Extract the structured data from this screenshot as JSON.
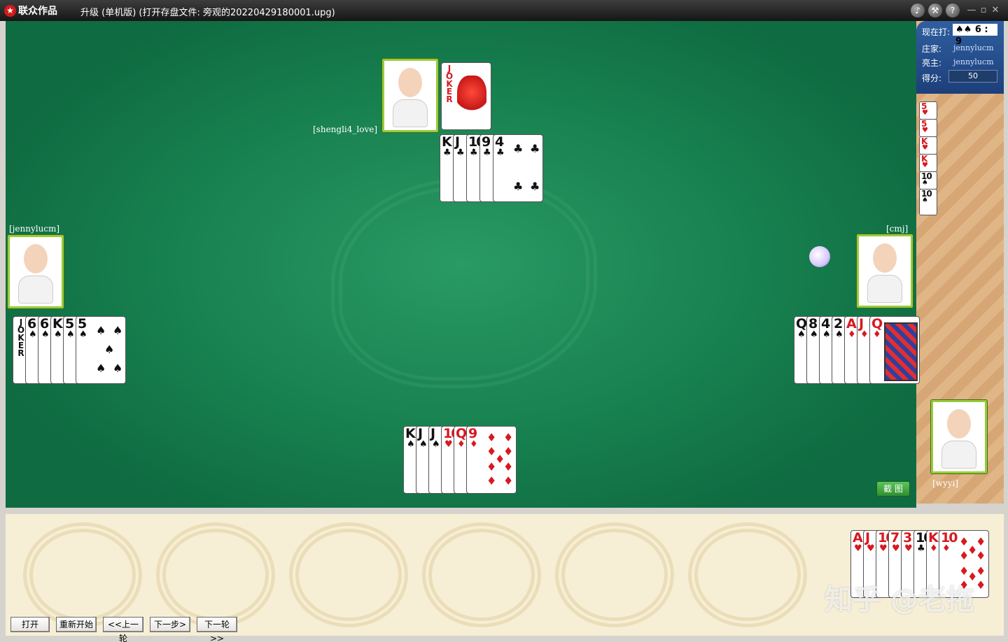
{
  "window": {
    "brand": "联众作品",
    "title": "升级 (单机版) (打开存盘文件: 旁观的20220429180001.upg)",
    "buttons": [
      "sound-icon",
      "tools-icon",
      "help-icon"
    ],
    "controls": [
      "—",
      "▫",
      "✕"
    ]
  },
  "info": {
    "now_label": "现在打:",
    "now_value": "♠♠ 6 : 9",
    "dealer_label": "庄家:",
    "dealer_value": "jennylucm",
    "declarer_label": "亮主:",
    "declarer_value": "jennylucm",
    "score_label": "得分:",
    "score_value": "50"
  },
  "players": {
    "top": "[shengli4_love]",
    "left": "[jennylucm]",
    "right": "[cmj]",
    "bottom": "[wyyi]"
  },
  "played": {
    "top_single": [
      {
        "rank": "JOKER",
        "suit": "",
        "color": "red"
      }
    ],
    "top": [
      {
        "rank": "K",
        "suit": "♣",
        "color": "blk"
      },
      {
        "rank": "J",
        "suit": "♣",
        "color": "blk"
      },
      {
        "rank": "10",
        "suit": "♣",
        "color": "blk"
      },
      {
        "rank": "9",
        "suit": "♣",
        "color": "blk"
      },
      {
        "rank": "4",
        "suit": "♣",
        "color": "blk"
      }
    ],
    "left": [
      {
        "rank": "JOKER",
        "suit": "",
        "color": "blk"
      },
      {
        "rank": "6",
        "suit": "♠",
        "color": "blk"
      },
      {
        "rank": "6",
        "suit": "♠",
        "color": "blk"
      },
      {
        "rank": "K",
        "suit": "♠",
        "color": "blk"
      },
      {
        "rank": "5",
        "suit": "♠",
        "color": "blk"
      },
      {
        "rank": "5",
        "suit": "♠",
        "color": "blk"
      }
    ],
    "right": [
      {
        "rank": "Q",
        "suit": "♠",
        "color": "blk"
      },
      {
        "rank": "8",
        "suit": "♠",
        "color": "blk"
      },
      {
        "rank": "4",
        "suit": "♠",
        "color": "blk"
      },
      {
        "rank": "2",
        "suit": "♠",
        "color": "blk"
      },
      {
        "rank": "A",
        "suit": "♦",
        "color": "red"
      },
      {
        "rank": "J",
        "suit": "♦",
        "color": "red"
      },
      {
        "rank": "Q",
        "suit": "♦",
        "color": "red"
      }
    ],
    "center": [
      {
        "rank": "K",
        "suit": "♠",
        "color": "blk"
      },
      {
        "rank": "J",
        "suit": "♠",
        "color": "blk"
      },
      {
        "rank": "J",
        "suit": "♠",
        "color": "blk"
      },
      {
        "rank": "10",
        "suit": "♥",
        "color": "red"
      },
      {
        "rank": "Q",
        "suit": "♦",
        "color": "red"
      },
      {
        "rank": "9",
        "suit": "♦",
        "color": "red"
      }
    ]
  },
  "points_cards": [
    {
      "rank": "5",
      "suit": "♥",
      "color": "red"
    },
    {
      "rank": "5",
      "suit": "♥",
      "color": "red"
    },
    {
      "rank": "K",
      "suit": "♥",
      "color": "red"
    },
    {
      "rank": "K",
      "suit": "♥",
      "color": "red"
    },
    {
      "rank": "10",
      "suit": "♠",
      "color": "blk"
    },
    {
      "rank": "10",
      "suit": "♠",
      "color": "blk"
    }
  ],
  "hand": [
    {
      "rank": "A",
      "suit": "♥",
      "color": "red"
    },
    {
      "rank": "J",
      "suit": "♥",
      "color": "red"
    },
    {
      "rank": "10",
      "suit": "♥",
      "color": "red"
    },
    {
      "rank": "7",
      "suit": "♥",
      "color": "red"
    },
    {
      "rank": "3",
      "suit": "♥",
      "color": "red"
    },
    {
      "rank": "10",
      "suit": "♣",
      "color": "blk"
    },
    {
      "rank": "K",
      "suit": "♦",
      "color": "red"
    },
    {
      "rank": "10",
      "suit": "♦",
      "color": "red"
    }
  ],
  "capture_label": "截 图",
  "controls": {
    "open": "打开",
    "restart": "重新开始",
    "prev_round": "<<上一轮",
    "next_step": "下一步>",
    "next_round": "下一轮>>"
  },
  "watermark": "知乎 @老拖"
}
